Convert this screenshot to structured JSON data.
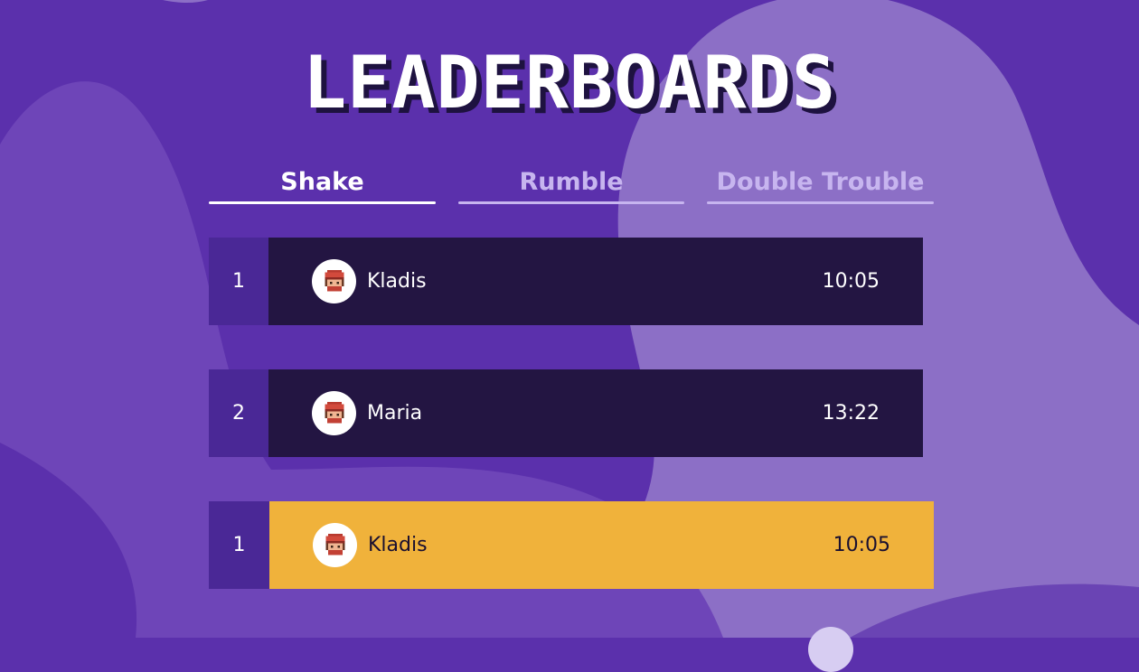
{
  "title": "LEADERBOARDS",
  "colors": {
    "background": "#5b30ac",
    "row_background": "#231542",
    "rank_background": "#4a2896",
    "highlight": "#f0b23b",
    "tab_active": "#ffffff",
    "tab_inactive": "#c7b5ef"
  },
  "tabs": [
    {
      "label": "Shake",
      "active": true
    },
    {
      "label": "Rumble",
      "active": false
    },
    {
      "label": "Double Trouble",
      "active": false
    }
  ],
  "entries": [
    {
      "rank": "1",
      "name": "Kladis",
      "time": "10:05",
      "avatar_icon": "pixel-character-icon"
    },
    {
      "rank": "2",
      "name": "Maria",
      "time": "13:22",
      "avatar_icon": "pixel-character-icon"
    }
  ],
  "current_player": {
    "rank": "1",
    "name": "Kladis",
    "time": "10:05",
    "avatar_icon": "pixel-character-icon"
  }
}
